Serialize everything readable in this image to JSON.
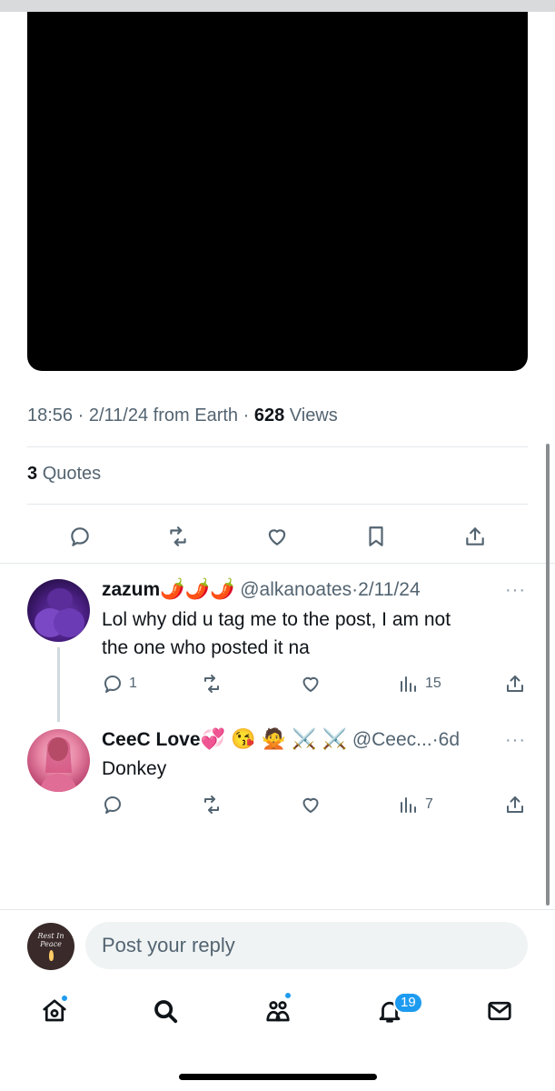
{
  "post": {
    "time": "18:56",
    "date": "2/11/24",
    "source": "from Earth",
    "sep": "·",
    "views_count": "628",
    "views_label": "Views",
    "quotes_count": "3",
    "quotes_label": "Quotes"
  },
  "replies": [
    {
      "name": "zazum",
      "emoji": "🌶️🌶️🌶️",
      "handle": "@alkanoates",
      "sep": "·",
      "time": "2/11/24",
      "more": "···",
      "text_line1": "Lol why did u tag me to the post, I am not",
      "text_line2": "the one who posted it na",
      "reply_count": "1",
      "views_count": "15"
    },
    {
      "name": "CeeC Love",
      "emoji": "💞 😘 🙅 ⚔️ ⚔️",
      "handle": "@Ceec...",
      "sep": "·",
      "time": "6d",
      "more": "···",
      "text_line1": "Donkey",
      "views_count": "7"
    }
  ],
  "reply_box": {
    "placeholder": "Post your reply",
    "avatar_text": "Rest In Peace"
  },
  "tabbar": {
    "notifications_badge": "19",
    "icons": [
      "home-icon",
      "search-icon",
      "communities-icon",
      "notifications-icon",
      "messages-icon"
    ]
  },
  "colors": {
    "accent": "#1d9bf0",
    "secondary_text": "#536471"
  }
}
